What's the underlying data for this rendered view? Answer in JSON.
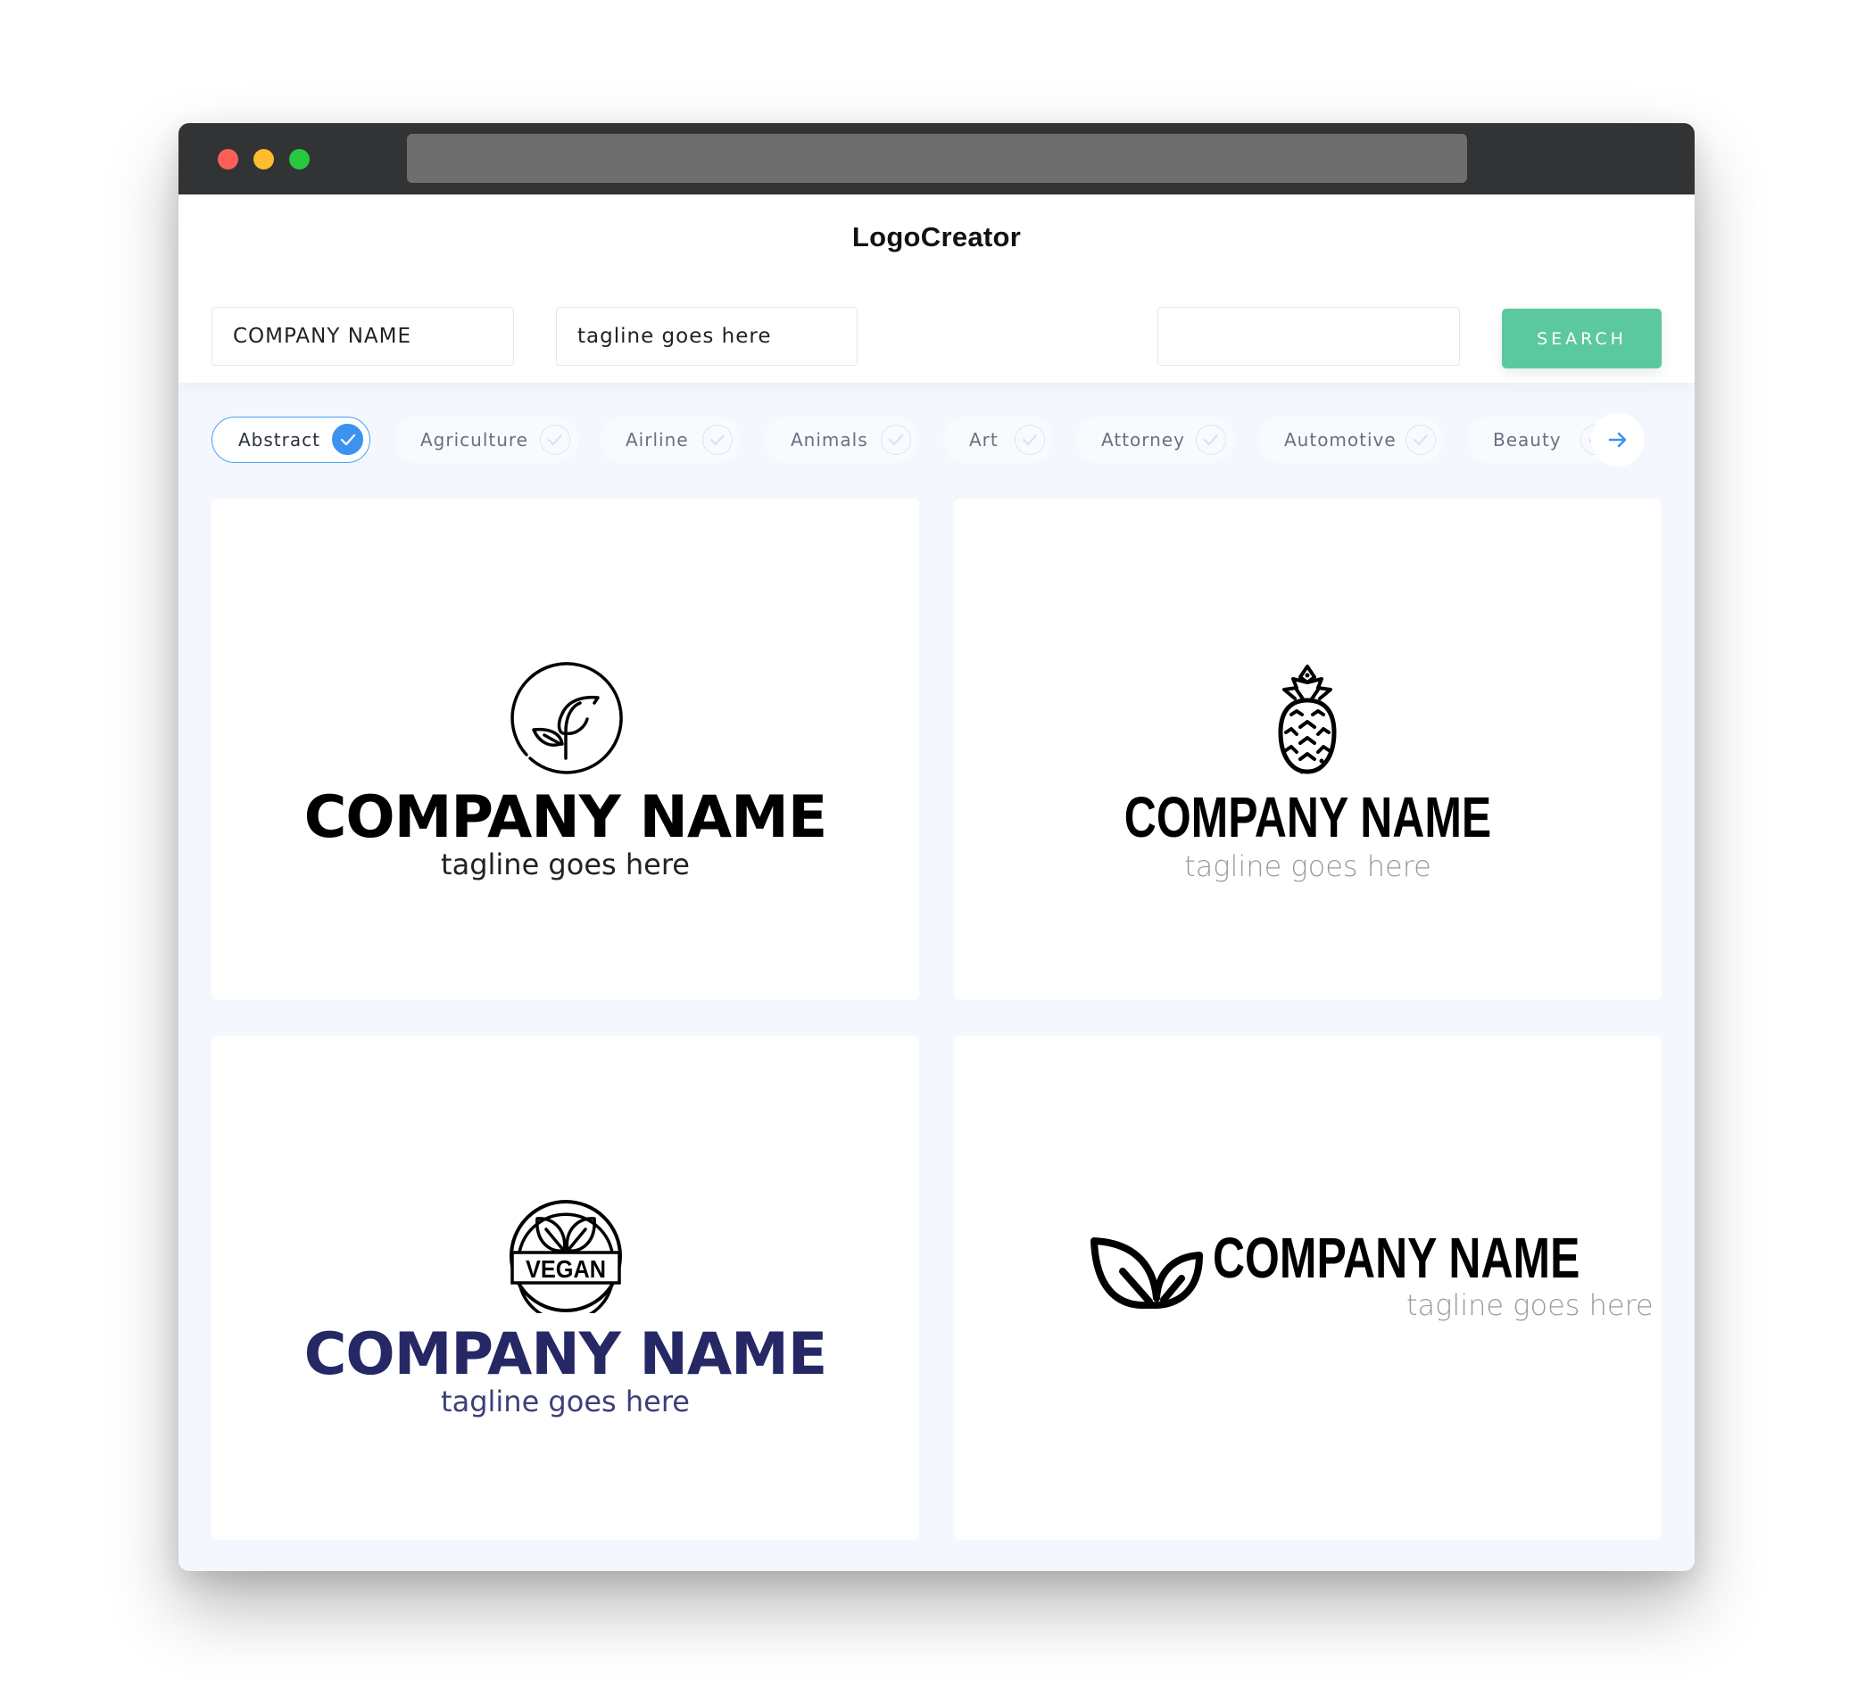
{
  "app": {
    "title": "LogoCreator"
  },
  "window": {
    "traffic_lights": [
      "close",
      "minimize",
      "maximize"
    ]
  },
  "search": {
    "company_value": "COMPANY NAME",
    "tagline_value": "tagline goes here",
    "extra_value": "",
    "button_label": "SEARCH"
  },
  "categories": [
    {
      "label": "Abstract",
      "selected": true
    },
    {
      "label": "Agriculture",
      "selected": false
    },
    {
      "label": "Airline",
      "selected": false
    },
    {
      "label": "Animals",
      "selected": false
    },
    {
      "label": "Art",
      "selected": false
    },
    {
      "label": "Attorney",
      "selected": false
    },
    {
      "label": "Automotive",
      "selected": false
    },
    {
      "label": "Beauty",
      "selected": false
    }
  ],
  "next_icon": "arrow-right-icon",
  "logos": [
    {
      "icon": "sprout-circle-icon",
      "company": "COMPANY NAME",
      "tagline": "tagline goes here",
      "color": "#000000"
    },
    {
      "icon": "pineapple-icon",
      "company": "COMPANY NAME",
      "tagline": "tagline goes here",
      "color": "#000000"
    },
    {
      "icon": "vegan-badge-icon",
      "company": "COMPANY NAME",
      "tagline": "tagline goes here",
      "color": "#262765",
      "badge_text": "VEGAN"
    },
    {
      "icon": "leaves-icon",
      "company": "COMPANY NAME",
      "tagline": "tagline goes here",
      "color": "#000000"
    }
  ],
  "colors": {
    "accent": "#3d92f0",
    "search_button": "#5bc8a0",
    "brand_navy": "#262765"
  }
}
